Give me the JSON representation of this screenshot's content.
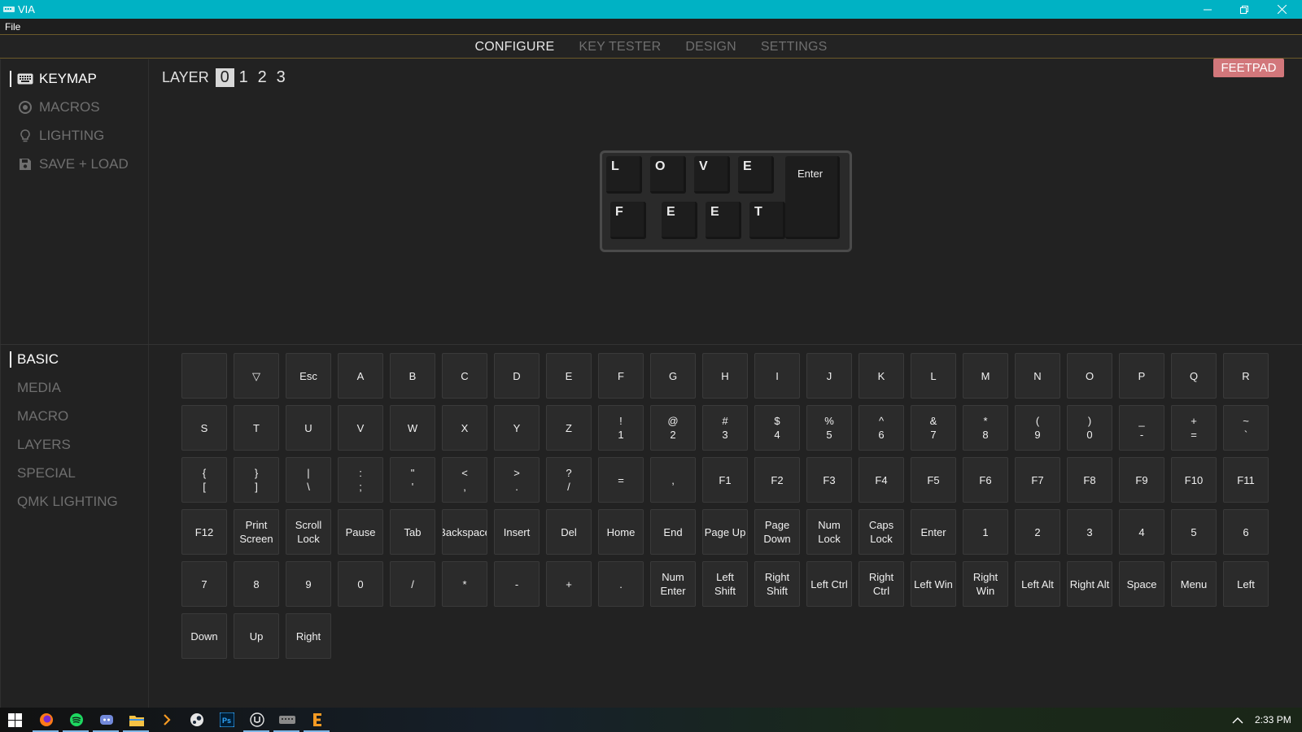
{
  "window": {
    "title": "VIA"
  },
  "menu": {
    "file": "File"
  },
  "nav": {
    "tabs": [
      "CONFIGURE",
      "KEY TESTER",
      "DESIGN",
      "SETTINGS"
    ],
    "active": 0
  },
  "sidebar": {
    "items": [
      {
        "label": "KEYMAP",
        "icon": "keyboard-icon"
      },
      {
        "label": "MACROS",
        "icon": "circle-dot-icon"
      },
      {
        "label": "LIGHTING",
        "icon": "lightbulb-icon"
      },
      {
        "label": "SAVE + LOAD",
        "icon": "floppy-disk-icon"
      }
    ]
  },
  "layer": {
    "label": "LAYER",
    "numbers": [
      "0",
      "1",
      "2",
      "3"
    ],
    "active": 0
  },
  "device": {
    "name": "FEETPAD"
  },
  "keyboard": {
    "row1": [
      "L",
      "O",
      "V",
      "E"
    ],
    "row2": [
      "F",
      "E",
      "E",
      "T"
    ],
    "enter": "Enter"
  },
  "categories": [
    "BASIC",
    "MEDIA",
    "MACRO",
    "LAYERS",
    "SPECIAL",
    "QMK LIGHTING"
  ],
  "keys": [
    [
      "",
      "▽",
      "Esc",
      "A",
      "B",
      "C",
      "D",
      "E",
      "F",
      "G",
      "H",
      "I",
      "J",
      "K",
      "L",
      "M",
      "N",
      "O",
      "P",
      "Q",
      "R"
    ],
    [
      "S",
      "T",
      "U",
      "V",
      "W",
      "X",
      "Y",
      "Z",
      "!\n1",
      "@\n2",
      "#\n3",
      "$\n4",
      "%\n5",
      "^\n6",
      "&\n7",
      "*\n8",
      "(\n9",
      ")\n0",
      "_\n-",
      "+\n=",
      "~\n`"
    ],
    [
      "{\n[",
      "}\n]",
      "|\n\\",
      ":\n;",
      "\"\n'",
      "<\n,",
      ">\n.",
      "?\n/",
      "=",
      ",",
      "F1",
      "F2",
      "F3",
      "F4",
      "F5",
      "F6",
      "F7",
      "F8",
      "F9",
      "F10",
      "F11"
    ],
    [
      "F12",
      "Print\nScreen",
      "Scroll\nLock",
      "Pause",
      "Tab",
      "Backspace",
      "Insert",
      "Del",
      "Home",
      "End",
      "Page Up",
      "Page\nDown",
      "Num\nLock",
      "Caps\nLock",
      "Enter",
      "1",
      "2",
      "3",
      "4",
      "5",
      "6"
    ],
    [
      "7",
      "8",
      "9",
      "0",
      "/",
      "*",
      "-",
      "+",
      ".",
      "Num\nEnter",
      "Left\nShift",
      "Right\nShift",
      "Left Ctrl",
      "Right\nCtrl",
      "Left Win",
      "Right\nWin",
      "Left Alt",
      "Right Alt",
      "Space",
      "Menu",
      "Left"
    ],
    [
      "Down",
      "Up",
      "Right"
    ]
  ],
  "taskbar": {
    "icons": [
      "windows-start-icon",
      "firefox-icon",
      "spotify-icon",
      "discord-icon",
      "file-explorer-icon",
      "chevron-right-icon",
      "steam-icon",
      "photoshop-icon",
      "unreal-icon",
      "via-icon",
      "epic-icon"
    ],
    "time": "2:33 PM"
  },
  "colors": {
    "titlebar": "#00b2c4",
    "badge": "#d2777b",
    "background": "#222222"
  }
}
